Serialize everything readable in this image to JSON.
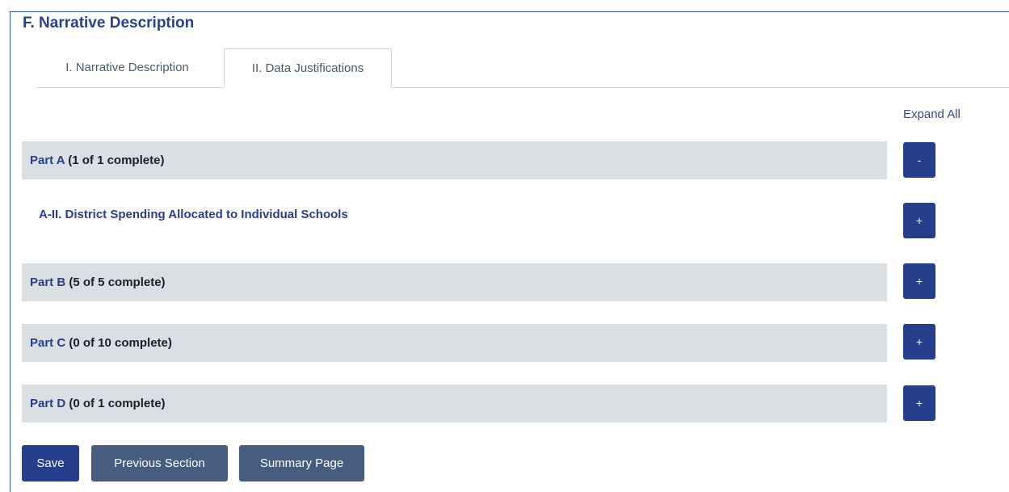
{
  "section": {
    "title": "F. Narrative Description"
  },
  "tabs": [
    {
      "label": "I. Narrative Description",
      "active": false
    },
    {
      "label": "II. Data Justifications",
      "active": true
    }
  ],
  "expand_all": "Expand All",
  "parts": [
    {
      "name": "Part A",
      "count": " (1 of 1 complete)",
      "toggle": "-",
      "expanded": true,
      "items": [
        {
          "label": "A-II. District Spending Allocated to Individual Schools",
          "toggle": "+"
        }
      ]
    },
    {
      "name": "Part B",
      "count": " (5 of 5 complete)",
      "toggle": "+",
      "expanded": false
    },
    {
      "name": "Part C",
      "count": " (0 of 10 complete)",
      "toggle": "+",
      "expanded": false
    },
    {
      "name": "Part D",
      "count": " (0 of 1 complete)",
      "toggle": "+",
      "expanded": false
    }
  ],
  "buttons": {
    "save": "Save",
    "previous": "Previous Section",
    "summary": "Summary Page"
  },
  "colors": {
    "primary": "#253f8c",
    "secondary": "#475d80",
    "row_bg": "#d9dfe3",
    "heading": "#28418a"
  }
}
